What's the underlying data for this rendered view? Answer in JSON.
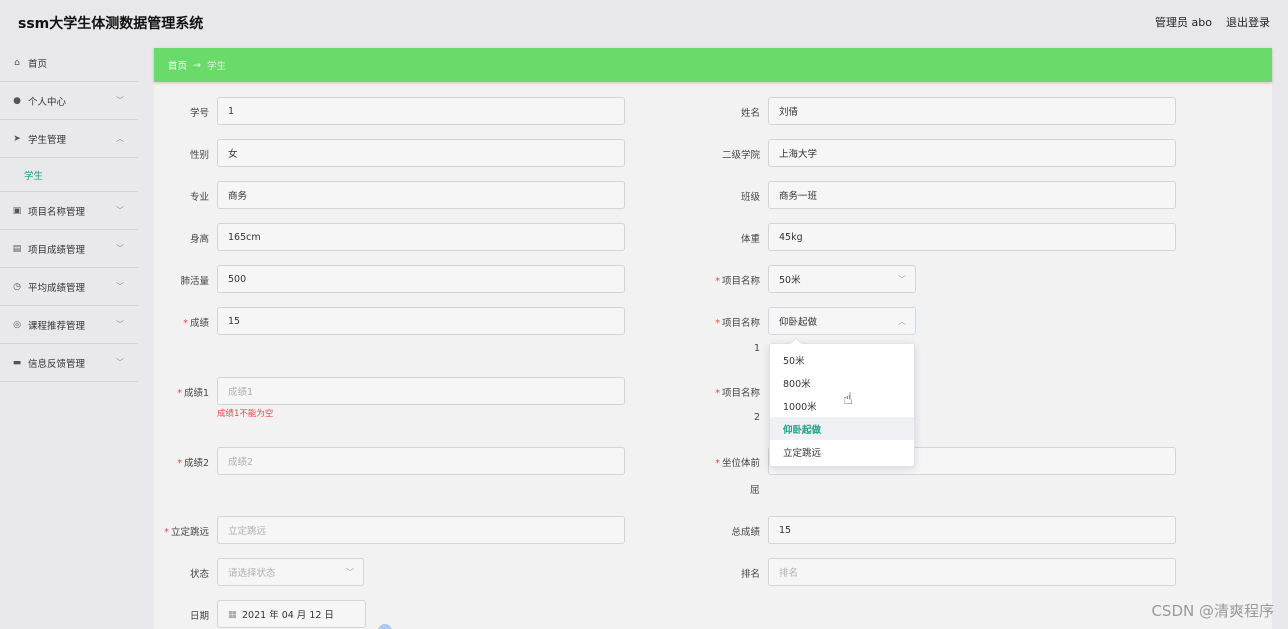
{
  "header": {
    "title": "ssm大学生体测数据管理系统",
    "user": "管理员 abo",
    "logout": "退出登录"
  },
  "sidebar": {
    "items": [
      {
        "label": "首页",
        "icon": "home-icon"
      },
      {
        "label": "个人中心",
        "icon": "user-icon"
      },
      {
        "label": "学生管理",
        "icon": "send-icon"
      },
      {
        "label": "学生",
        "icon": ""
      },
      {
        "label": "项目名称管理",
        "icon": "trash-icon"
      },
      {
        "label": "项目成绩管理",
        "icon": "list-icon"
      },
      {
        "label": "平均成绩管理",
        "icon": "clock-icon"
      },
      {
        "label": "课程推荐管理",
        "icon": "target-icon"
      },
      {
        "label": "信息反馈管理",
        "icon": "printer-icon"
      }
    ]
  },
  "breadcrumb": {
    "home": "首页",
    "arrow": "→",
    "current": "学生"
  },
  "form": {
    "xuehao_label": "学号",
    "xuehao": "1",
    "xingming_label": "姓名",
    "xingming": "刘倩",
    "xingbie_label": "性别",
    "xingbie": "女",
    "xueyuan_label": "二级学院",
    "xueyuan": "上海大学",
    "zhuanye_label": "专业",
    "zhuanye": "商务",
    "banji_label": "班级",
    "banji": "商务一班",
    "shengao_label": "身高",
    "shengao": "165cm",
    "tizhong_label": "体重",
    "tizhong": "45kg",
    "feihuoliang_label": "肺活量",
    "feihuoliang": "500",
    "xiangmu_label": "项目名称",
    "xiangmu": "50米",
    "chengji_label": "成绩",
    "chengji": "15",
    "xiangmu1_label": "项目名称",
    "xiangmu1": "仰卧起做",
    "xiangmu1_suffix": "1",
    "chengji1_label": "成绩1",
    "chengji1_placeholder": "成绩1",
    "chengji1_error": "成绩1不能为空",
    "xiangmu2_label": "项目名称",
    "xiangmu2_suffix": "2",
    "chengji2_label": "成绩2",
    "chengji2_placeholder": "成绩2",
    "zuowei_label": "坐位体前",
    "zuowei_suffix": "屈",
    "lidingtiaoyuan_label": "立定跳远",
    "lidingtiaoyuan_placeholder": "立定跳远",
    "zongchengji_label": "总成绩",
    "zongchengji": "15",
    "zhuangtai_label": "状态",
    "zhuangtai_placeholder": "请选择状态",
    "paiming_label": "排名",
    "paiming_placeholder": "排名",
    "riqi_label": "日期",
    "riqi": "2021 年 04 月 12 日"
  },
  "dropdown": {
    "options": [
      "50米",
      "800米",
      "1000米",
      "仰卧起做",
      "立定跳远"
    ],
    "selected": "仰卧起做"
  },
  "watermark": "CSDN @清爽程序"
}
